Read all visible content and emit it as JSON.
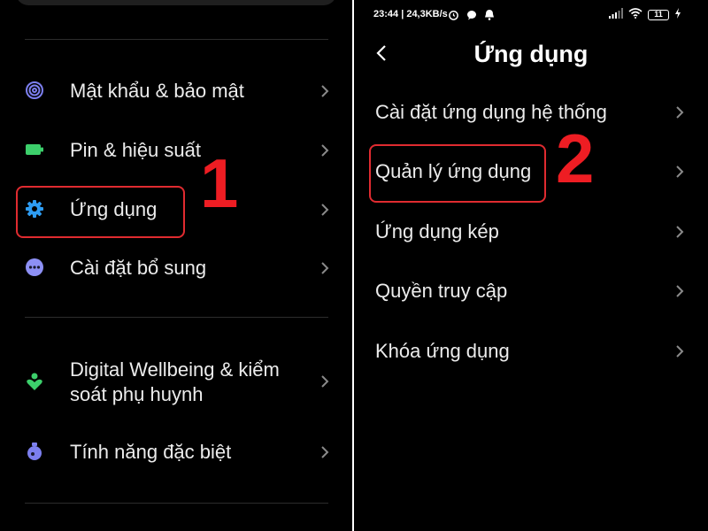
{
  "left": {
    "items": [
      {
        "label": "Mật khẩu & bảo mật",
        "icon": "fingerprint-icon",
        "color": "#7c7fef"
      },
      {
        "label": "Pin & hiệu suất",
        "icon": "battery-icon",
        "color": "#3ccf6b"
      },
      {
        "label": "Ứng dụng",
        "icon": "gear-icon",
        "color": "#2e9cf2"
      },
      {
        "label": "Cài đặt bổ sung",
        "icon": "more-dots-icon",
        "color": "#8d90f5"
      },
      {
        "label_line1": "Digital Wellbeing & kiểm",
        "label_line2": "soát phụ huynh",
        "icon": "heart-person-icon",
        "color": "#3ccf6b"
      },
      {
        "label": "Tính năng đặc biệt",
        "icon": "flask-icon",
        "color": "#7c7fef"
      }
    ],
    "step_number": "1"
  },
  "right": {
    "status_bar": {
      "time_speed": "23:44 | 24,3KB/s",
      "battery_level": "11"
    },
    "title": "Ứng dụng",
    "items": [
      {
        "label": "Cài đặt ứng dụng hệ thống"
      },
      {
        "label": "Quản lý ứng dụng"
      },
      {
        "label": "Ứng dụng kép"
      },
      {
        "label": "Quyền truy cập"
      },
      {
        "label": "Khóa ứng dụng"
      }
    ],
    "step_number": "2"
  },
  "colors": {
    "background": "#000000",
    "text": "#ececec",
    "chevron": "#8a8a8a",
    "highlight": "#e02b30",
    "step_number": "#ee1d23"
  }
}
